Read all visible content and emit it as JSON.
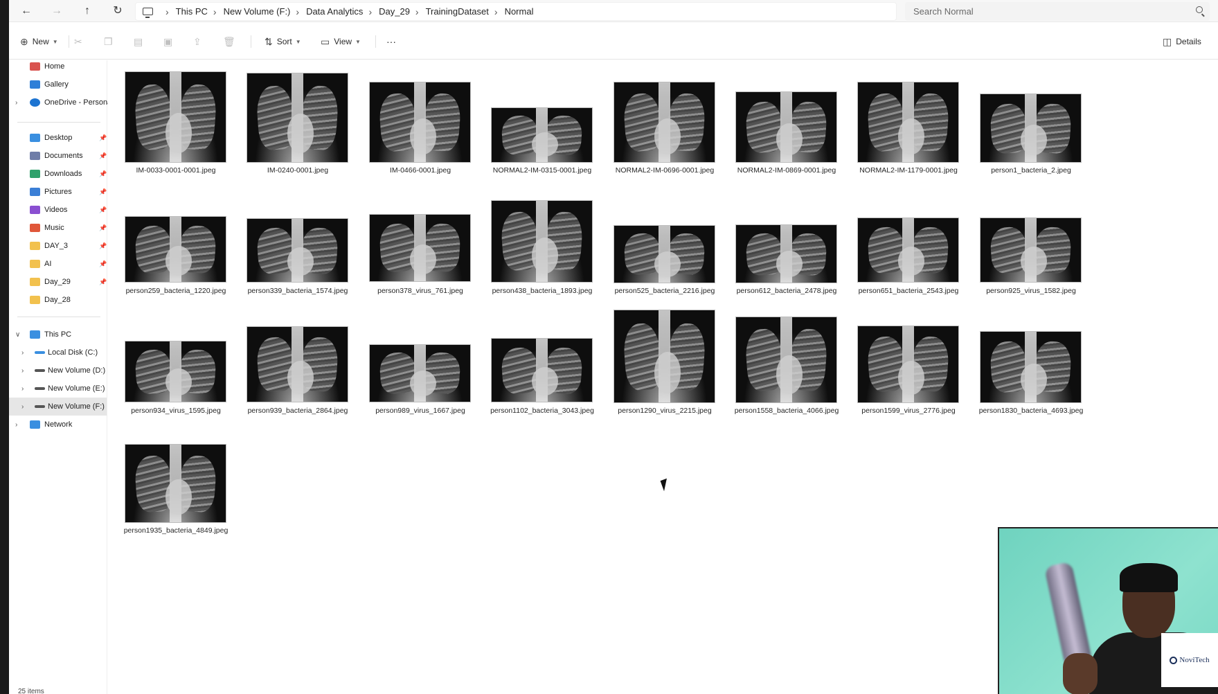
{
  "address_bar": {
    "back_glyph": "←",
    "forward_glyph": "→",
    "up_glyph": "↑",
    "refresh_glyph": "↻",
    "breadcrumbs": [
      "This PC",
      "New Volume (F:)",
      "Data Analytics",
      "Day_29",
      "TrainingDataset",
      "Normal"
    ],
    "search_placeholder": "Search Normal"
  },
  "command_bar": {
    "new_label": "New",
    "sort_label": "Sort",
    "view_label": "View",
    "more_label": "···",
    "details_label": "Details"
  },
  "sidebar": {
    "quick": [
      {
        "label": "Home",
        "icon": "home-icon",
        "color": "#d9534f"
      },
      {
        "label": "Gallery",
        "icon": "gallery-icon",
        "color": "#2f7fd8"
      },
      {
        "label": "OneDrive - Personal",
        "icon": "cloud-icon",
        "color": "#1d74d1"
      }
    ],
    "pinned": [
      {
        "label": "Desktop",
        "icon": "desktop-icon",
        "color": "#3a8fe0"
      },
      {
        "label": "Documents",
        "icon": "documents-icon",
        "color": "#6f7da8"
      },
      {
        "label": "Downloads",
        "icon": "downloads-icon",
        "color": "#2fa16b"
      },
      {
        "label": "Pictures",
        "icon": "pictures-icon",
        "color": "#3b7fd6"
      },
      {
        "label": "Videos",
        "icon": "videos-icon",
        "color": "#8a4fd1"
      },
      {
        "label": "Music",
        "icon": "music-icon",
        "color": "#e0573a"
      },
      {
        "label": "DAY_3",
        "icon": "folder-icon",
        "color": "#f2c14e"
      },
      {
        "label": "AI",
        "icon": "folder-icon",
        "color": "#f2c14e"
      },
      {
        "label": "Day_29",
        "icon": "folder-icon",
        "color": "#f2c14e"
      },
      {
        "label": "Day_28",
        "icon": "folder-icon",
        "color": "#f2c14e"
      }
    ],
    "this_pc_label": "This PC",
    "drives": [
      {
        "label": "Local Disk (C:)",
        "icon": "windows-drive-icon",
        "color": "#3a8fe0"
      },
      {
        "label": "New Volume (D:)",
        "icon": "drive-icon",
        "color": "#555555"
      },
      {
        "label": "New Volume (E:)",
        "icon": "drive-icon",
        "color": "#555555"
      },
      {
        "label": "New Volume (F:)",
        "icon": "drive-icon",
        "color": "#555555"
      }
    ],
    "network_label": "Network"
  },
  "files": [
    {
      "name": "IM-0033-0001-0001.jpeg"
    },
    {
      "name": "IM-0240-0001.jpeg"
    },
    {
      "name": "IM-0466-0001.jpeg"
    },
    {
      "name": "NORMAL2-IM-0315-0001.jpeg"
    },
    {
      "name": "NORMAL2-IM-0696-0001.jpeg"
    },
    {
      "name": "NORMAL2-IM-0869-0001.jpeg"
    },
    {
      "name": "NORMAL2-IM-1179-0001.jpeg"
    },
    {
      "name": "person1_bacteria_2.jpeg"
    },
    {
      "name": "person259_bacteria_1220.jpeg"
    },
    {
      "name": "person339_bacteria_1574.jpeg"
    },
    {
      "name": "person378_virus_761.jpeg"
    },
    {
      "name": "person438_bacteria_1893.jpeg"
    },
    {
      "name": "person525_bacteria_2216.jpeg"
    },
    {
      "name": "person612_bacteria_2478.jpeg"
    },
    {
      "name": "person651_bacteria_2543.jpeg"
    },
    {
      "name": "person925_virus_1582.jpeg"
    },
    {
      "name": "person934_virus_1595.jpeg"
    },
    {
      "name": "person939_bacteria_2864.jpeg"
    },
    {
      "name": "person989_virus_1667.jpeg"
    },
    {
      "name": "person1102_bacteria_3043.jpeg"
    },
    {
      "name": "person1290_virus_2215.jpeg"
    },
    {
      "name": "person1558_bacteria_4066.jpeg"
    },
    {
      "name": "person1599_virus_2776.jpeg"
    },
    {
      "name": "person1830_bacteria_4693.jpeg"
    },
    {
      "name": "person1935_bacteria_4849.jpeg"
    }
  ],
  "status": {
    "item_count": "25 items"
  },
  "overlay": {
    "logo_text": "NoviTech"
  }
}
